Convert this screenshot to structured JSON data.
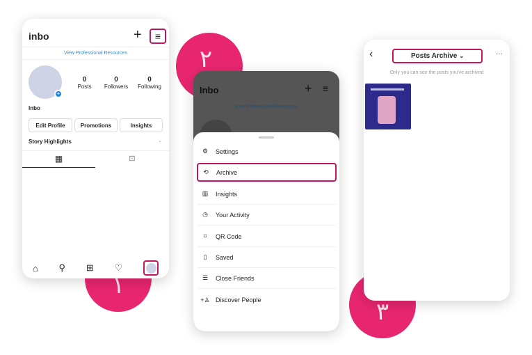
{
  "steps": [
    "١",
    "٢",
    "٣"
  ],
  "accent": "#e8266f",
  "profile": {
    "username": "inbo",
    "pro_link": "View Professional Resources",
    "stats": [
      {
        "value": "0",
        "label": "Posts"
      },
      {
        "value": "0",
        "label": "Followers"
      },
      {
        "value": "0",
        "label": "Following"
      }
    ],
    "name": "Inbo",
    "buttons": [
      "Edit Profile",
      "Promotions",
      "Insights"
    ],
    "highlights": "Story Highlights"
  },
  "menu_screen": {
    "username": "Inbo",
    "pro_link": "View Professional Resources",
    "items": [
      {
        "label": "Settings",
        "icon": "gear-icon"
      },
      {
        "label": "Archive",
        "icon": "archive-icon"
      },
      {
        "label": "Insights",
        "icon": "bar-chart-icon"
      },
      {
        "label": "Your Activity",
        "icon": "activity-icon"
      },
      {
        "label": "QR Code",
        "icon": "qr-code-icon"
      },
      {
        "label": "Saved",
        "icon": "bookmark-icon"
      },
      {
        "label": "Close Friends",
        "icon": "list-icon"
      },
      {
        "label": "Discover People",
        "icon": "add-person-icon"
      }
    ]
  },
  "archive": {
    "title": "Posts Archive",
    "subtitle": "Only you can see the posts you've archived"
  }
}
